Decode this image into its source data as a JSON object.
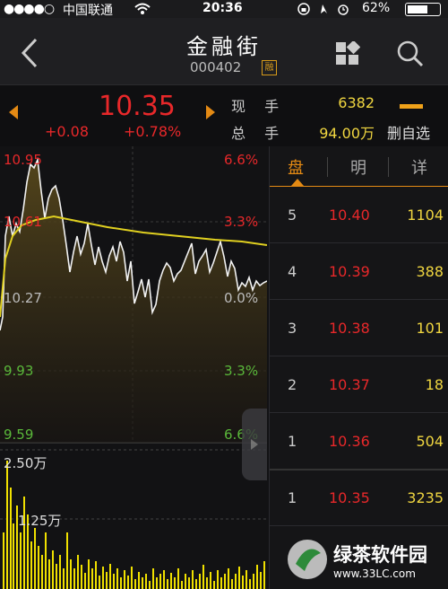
{
  "status_bar": {
    "signal": "●●●●○",
    "carrier": "中国联通",
    "time": "20:36",
    "battery": "62%"
  },
  "header": {
    "title": "金融街",
    "code": "000402",
    "badge": "融"
  },
  "quote": {
    "price": "10.35",
    "change": "+0.08",
    "change_pct": "+0.78%",
    "now_hand_label": "现 手",
    "now_hand_value": "6382",
    "total_hand_label": "总 手",
    "total_hand_value": "94.00万",
    "remove_watchlist": "删自选"
  },
  "chart": {
    "price_labels": [
      "10.95",
      "10.61",
      "10.27",
      "9.93",
      "9.59"
    ],
    "pct_labels": [
      "6.6%",
      "3.3%",
      "0.0%",
      "3.3%",
      "6.6%"
    ],
    "volume_labels": [
      "2.50万",
      "1.25万"
    ]
  },
  "orderbook": {
    "tabs": [
      "盘",
      "明",
      "详"
    ],
    "rows": [
      {
        "level": "5",
        "price": "10.40",
        "vol": "1104"
      },
      {
        "level": "4",
        "price": "10.39",
        "vol": "388"
      },
      {
        "level": "3",
        "price": "10.38",
        "vol": "101"
      },
      {
        "level": "2",
        "price": "10.37",
        "vol": "18"
      },
      {
        "level": "1",
        "price": "10.36",
        "vol": "504"
      },
      {
        "level": "1",
        "price": "10.35",
        "vol": "3235"
      }
    ]
  },
  "watermark": {
    "name": "绿茶软件园",
    "url": "www.33LC.com"
  },
  "colors": {
    "up": "#e8282a",
    "down": "#5ab83a",
    "accent": "#e48a14",
    "avg": "#e0d020",
    "volume": "#f0e000"
  }
}
